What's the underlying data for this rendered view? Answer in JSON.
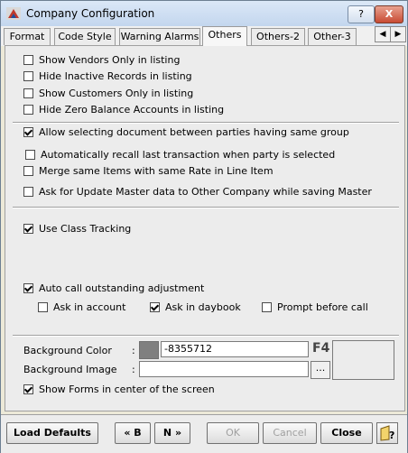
{
  "window": {
    "title": "Company Configuration",
    "help_glyph": "?",
    "close_glyph": "X"
  },
  "tabs": [
    {
      "label": "Format"
    },
    {
      "label": "Code Style"
    },
    {
      "label": "Warning Alarms"
    },
    {
      "label": "Others",
      "active": true
    },
    {
      "label": "Others-2"
    },
    {
      "label": "Other-3"
    }
  ],
  "tab_scroll": {
    "left": "◀",
    "right": "▶"
  },
  "options": {
    "show_vendors": {
      "label": "Show Vendors Only in listing",
      "checked": false
    },
    "hide_inactive": {
      "label": "Hide Inactive Records in listing",
      "checked": false
    },
    "show_customers": {
      "label": "Show Customers Only in listing",
      "checked": false
    },
    "hide_zero_balance": {
      "label": "Hide Zero Balance Accounts in listing",
      "checked": false
    },
    "allow_same_group": {
      "label": "Allow selecting document between parties having same group",
      "checked": true
    },
    "auto_recall": {
      "label": "Automatically recall last transaction when party is selected",
      "checked": false
    },
    "merge_items": {
      "label": "Merge same Items with same Rate in Line Item",
      "checked": false
    },
    "ask_update_master": {
      "label": "Ask for Update Master data to Other Company while saving Master",
      "checked": false
    },
    "class_tracking": {
      "label": "Use Class Tracking",
      "checked": true
    },
    "auto_call_outstanding": {
      "label": "Auto call outstanding adjustment",
      "checked": true
    },
    "ask_in_account": {
      "label": "Ask in account",
      "checked": false
    },
    "ask_in_daybook": {
      "label": "Ask in daybook",
      "checked": true
    },
    "prompt_before_call": {
      "label": "Prompt before call",
      "checked": false
    },
    "show_forms_center": {
      "label": "Show Forms in center of the screen",
      "checked": true
    }
  },
  "background": {
    "color_label": "Background Color",
    "color_colon": ":",
    "color_value": "-8355712",
    "swatch_color": "#808080",
    "f4_label": "F4",
    "image_label": "Background Image",
    "image_colon": ":",
    "image_value": "",
    "browse_label": "..."
  },
  "footer": {
    "load_defaults": "Load Defaults",
    "back": "« B",
    "next": "N »",
    "ok": "OK",
    "cancel": "Cancel",
    "close": "Close"
  }
}
